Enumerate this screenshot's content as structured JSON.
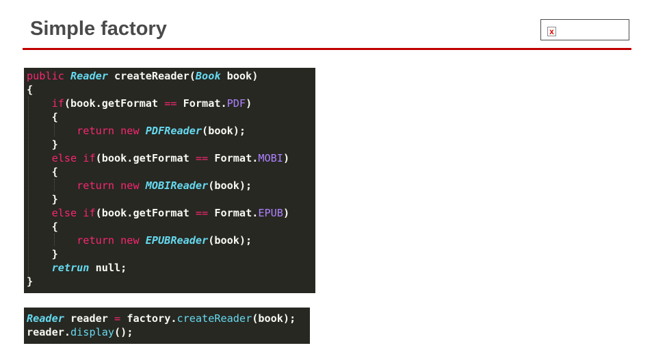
{
  "slide": {
    "title": "Simple factory",
    "image_placeholder_mark": "x"
  },
  "code_main": {
    "lines": [
      [
        {
          "t": "public ",
          "c": "kw"
        },
        {
          "t": "Reader",
          "c": "ty"
        },
        {
          "t": " createReader(",
          "c": ""
        },
        {
          "t": "Book",
          "c": "ty"
        },
        {
          "t": " book)",
          "c": ""
        }
      ],
      [
        {
          "t": "{",
          "c": ""
        }
      ],
      [
        {
          "t": "    ",
          "c": ""
        },
        {
          "t": "if",
          "c": "kw"
        },
        {
          "t": "(book.getFormat ",
          "c": ""
        },
        {
          "t": "==",
          "c": "op"
        },
        {
          "t": " Format.",
          "c": ""
        },
        {
          "t": "PDF",
          "c": "cn"
        },
        {
          "t": ")",
          "c": ""
        }
      ],
      [
        {
          "t": "    {",
          "c": ""
        }
      ],
      [
        {
          "t": "        ",
          "c": ""
        },
        {
          "t": "return new ",
          "c": "kw"
        },
        {
          "t": "PDFReader",
          "c": "ty"
        },
        {
          "t": "(book);",
          "c": ""
        }
      ],
      [
        {
          "t": "    }",
          "c": ""
        }
      ],
      [
        {
          "t": "    ",
          "c": ""
        },
        {
          "t": "else if",
          "c": "kw"
        },
        {
          "t": "(book.getFormat ",
          "c": ""
        },
        {
          "t": "==",
          "c": "op"
        },
        {
          "t": " Format.",
          "c": ""
        },
        {
          "t": "MOBI",
          "c": "cn"
        },
        {
          "t": ")",
          "c": ""
        }
      ],
      [
        {
          "t": "    {",
          "c": ""
        }
      ],
      [
        {
          "t": "        ",
          "c": ""
        },
        {
          "t": "return new ",
          "c": "kw"
        },
        {
          "t": "MOBIReader",
          "c": "ty"
        },
        {
          "t": "(book);",
          "c": ""
        }
      ],
      [
        {
          "t": "    }",
          "c": ""
        }
      ],
      [
        {
          "t": "    ",
          "c": ""
        },
        {
          "t": "else if",
          "c": "kw"
        },
        {
          "t": "(book.getFormat ",
          "c": ""
        },
        {
          "t": "==",
          "c": "op"
        },
        {
          "t": " Format.",
          "c": ""
        },
        {
          "t": "EPUB",
          "c": "cn"
        },
        {
          "t": ")",
          "c": ""
        }
      ],
      [
        {
          "t": "    {",
          "c": ""
        }
      ],
      [
        {
          "t": "        ",
          "c": ""
        },
        {
          "t": "return new ",
          "c": "kw"
        },
        {
          "t": "EPUBReader",
          "c": "ty"
        },
        {
          "t": "(book);",
          "c": ""
        }
      ],
      [
        {
          "t": "    }",
          "c": ""
        }
      ],
      [
        {
          "t": "    ",
          "c": ""
        },
        {
          "t": "retrun",
          "c": "ro"
        },
        {
          "t": " null;",
          "c": ""
        }
      ],
      [
        {
          "t": "}",
          "c": ""
        }
      ]
    ]
  },
  "code_usage": {
    "lines": [
      [
        {
          "t": "Reader",
          "c": "ty"
        },
        {
          "t": " reader ",
          "c": ""
        },
        {
          "t": "=",
          "c": "op"
        },
        {
          "t": " factory.",
          "c": ""
        },
        {
          "t": "createReader",
          "c": "fn"
        },
        {
          "t": "(book);",
          "c": ""
        }
      ],
      [
        {
          "t": "reader.",
          "c": ""
        },
        {
          "t": "display",
          "c": "fn"
        },
        {
          "t": "();",
          "c": ""
        }
      ]
    ]
  },
  "colors": {
    "editor_background": "#272822",
    "keyword": "#f92672",
    "type": "#66d9ef",
    "constant": "#ae81ff",
    "title_rule": "#c00000"
  }
}
